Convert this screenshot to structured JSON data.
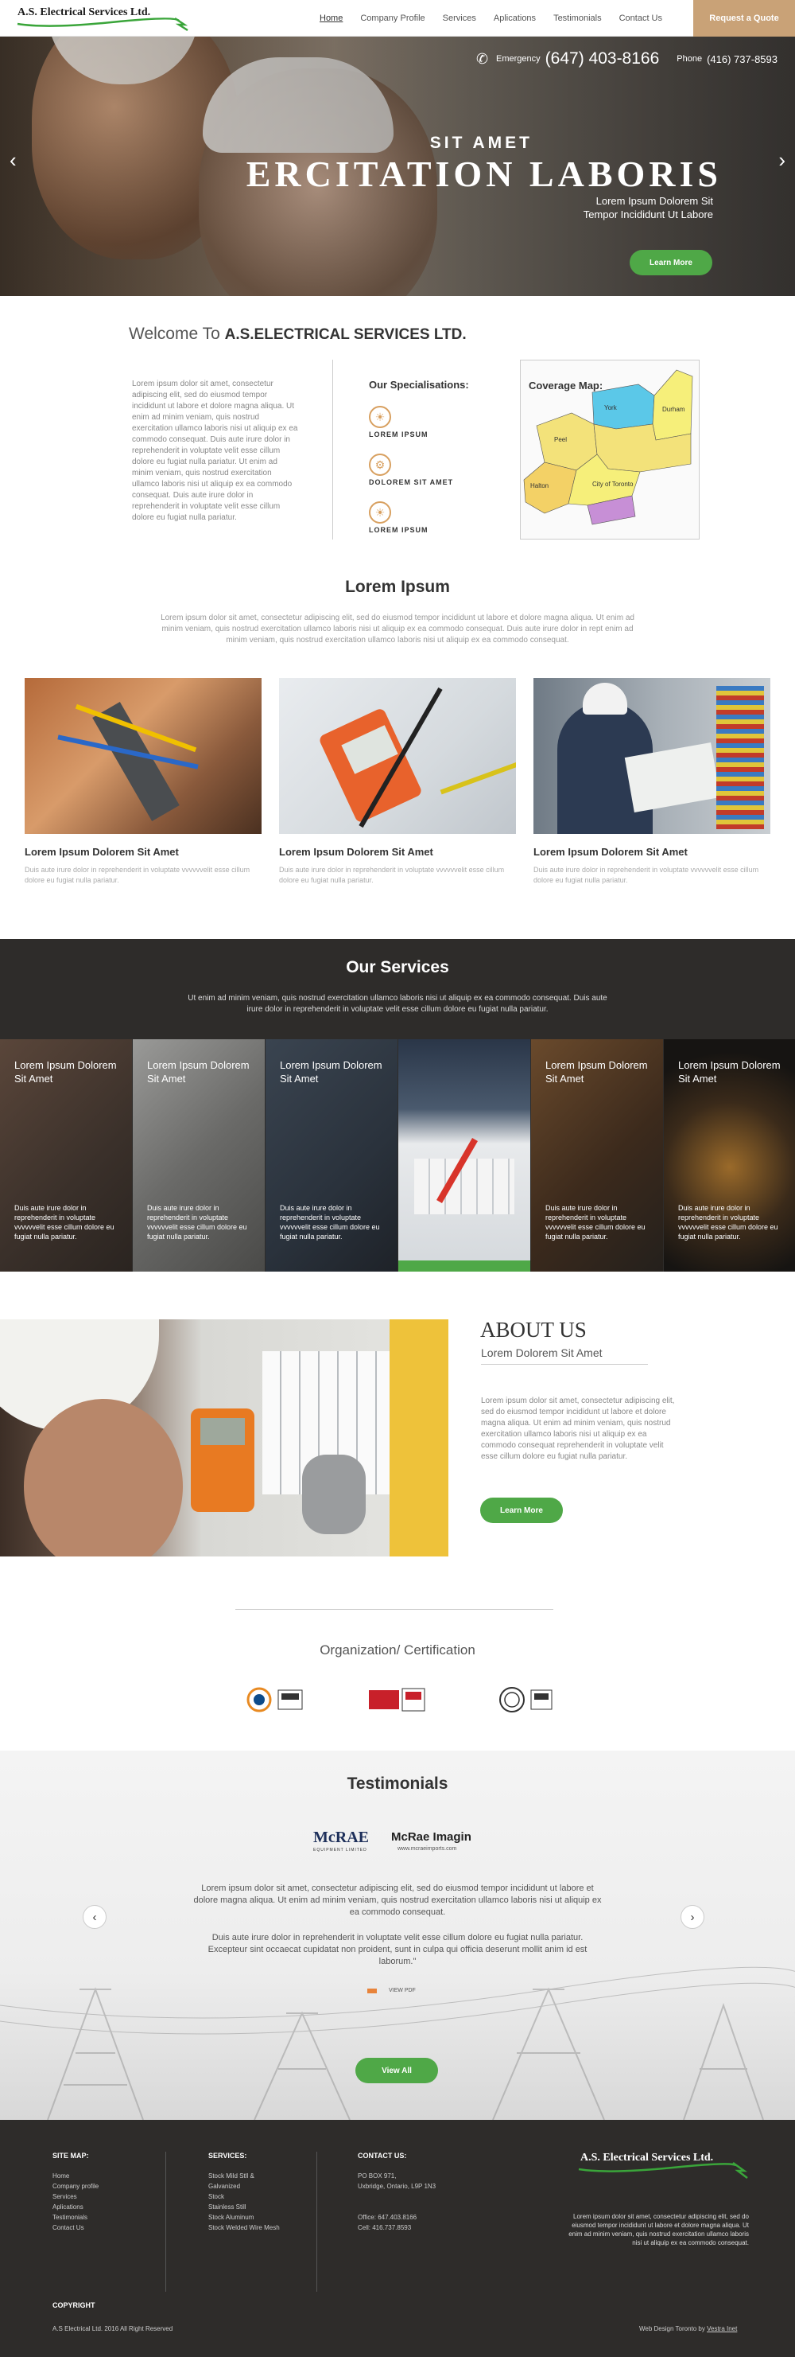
{
  "header": {
    "logo": "A.S. Electrical Services Ltd.",
    "nav": [
      "Home",
      "Company Profile",
      "Services",
      "Aplications",
      "Testimonials",
      "Contact Us"
    ],
    "quote_button": "Request a Quote"
  },
  "hero": {
    "emergency_label": "Emergency",
    "emergency_phone": "(647) 403-8166",
    "phone_label": "Phone",
    "phone": "(416) 737-8593",
    "subtitle": "SIT AMET",
    "title": "ERCITATION LABORIS",
    "tagline_1": "Lorem Ipsum Dolorem Sit",
    "tagline_2": "Tempor Incididunt Ut Labore",
    "button": "Learn More"
  },
  "welcome": {
    "title_prefix": "Welcome To ",
    "title_bold": "A.S.ELECTRICAL SERVICES LTD.",
    "paragraph": "Lorem ipsum dolor sit amet, consectetur adipiscing elit, sed do eiusmod tempor incididunt ut labore et dolore magna aliqua. Ut enim ad minim veniam, quis nostrud exercitation ullamco laboris nisi ut aliquip ex ea commodo consequat. Duis aute irure dolor in reprehenderit in voluptate velit esse cillum dolore eu fugiat nulla pariatur. Ut enim ad minim veniam, quis nostrud exercitation ullamco laboris nisi ut aliquip ex ea commodo consequat. Duis aute irure dolor in reprehenderit in voluptate velit esse cillum dolore eu fugiat nulla pariatur.",
    "specialisations_title": "Our Specialisations:",
    "specialisations": [
      "LOREM IPSUM",
      "DOLOREM SIT AMET",
      "LOREM IPSUM"
    ],
    "map_title": "Coverage Map:",
    "map_regions": [
      "York",
      "Durham",
      "Peel",
      "Halton",
      "City of Toronto"
    ]
  },
  "lorem": {
    "title": "Lorem Ipsum",
    "paragraph": "Lorem ipsum dolor sit amet, consectetur adipiscing elit, sed do eiusmod tempor incididunt ut labore et dolore magna aliqua. Ut enim ad minim veniam, quis nostrud exercitation ullamco laboris nisi ut aliquip ex ea commodo consequat. Duis aute irure dolor in rept enim ad minim veniam, quis nostrud exercitation ullamco laboris nisi ut aliquip ex ea commodo consequat.",
    "cards": [
      {
        "title": "Lorem Ipsum Dolorem Sit Amet",
        "text": "Duis aute irure dolor in reprehenderit in voluptate vvvvvvelit esse cillum dolore eu fugiat nulla pariatur."
      },
      {
        "title": "Lorem Ipsum Dolorem Sit Amet",
        "text": "Duis aute irure dolor in reprehenderit in voluptate vvvvvvelit esse cillum dolore eu fugiat nulla pariatur."
      },
      {
        "title": "Lorem Ipsum Dolorem Sit Amet",
        "text": "Duis aute irure dolor in reprehenderit in voluptate vvvvvvelit esse cillum dolore eu fugiat nulla pariatur."
      }
    ]
  },
  "services": {
    "title": "Our Services",
    "paragraph": "Ut enim ad minim veniam, quis nostrud exercitation ullamco laboris nisi ut aliquip ex ea commodo consequat. Duis aute irure dolor in reprehenderit in voluptate velit esse cillum dolore eu fugiat nulla pariatur.",
    "items": [
      {
        "title": "Lorem Ipsum Dolorem Sit Amet",
        "text": "Duis aute irure dolor in reprehenderit in voluptate vvvvvvelit esse cillum dolore eu fugiat nulla pariatur."
      },
      {
        "title": "Lorem Ipsum Dolorem Sit Amet",
        "text": "Duis aute irure dolor in reprehenderit in voluptate vvvvvvelit esse cillum dolore eu fugiat nulla pariatur."
      },
      {
        "title": "Lorem Ipsum Dolorem Sit Amet",
        "text": "Duis aute irure dolor in reprehenderit in voluptate vvvvvvelit esse cillum dolore eu fugiat nulla pariatur."
      },
      {
        "title": "",
        "text": ""
      },
      {
        "title": "Lorem Ipsum Dolorem Sit Amet",
        "text": "Duis aute irure dolor in reprehenderit in voluptate vvvvvvelit esse cillum dolore eu fugiat nulla pariatur."
      },
      {
        "title": "Lorem Ipsum Dolorem Sit Amet",
        "text": "Duis aute irure dolor in reprehenderit in voluptate vvvvvvelit esse cillum dolore eu fugiat nulla pariatur."
      }
    ]
  },
  "about": {
    "title": "ABOUT US",
    "subtitle": "Lorem Dolorem Sit Amet",
    "paragraph": "Lorem ipsum dolor sit amet, consectetur adipiscing elit, sed do eiusmod tempor incididunt ut labore et dolore magna aliqua. Ut enim ad minim veniam, quis nostrud exercitation ullamco laboris nisi ut aliquip ex ea commodo consequat reprehenderit in voluptate velit esse cillum dolore eu fugiat nulla pariatur.",
    "button": "Learn More"
  },
  "certification": {
    "title": "Organization/ Certification"
  },
  "testimonials": {
    "title": "Testimonials",
    "logo_1": "McRAE",
    "logo_1_sub": "EQUIPMENT LIMITED",
    "logo_2": "McRae Imagin",
    "logo_2_sub": "www.mcraeimports.com",
    "quote_1": "Lorem ipsum dolor sit amet, consectetur adipiscing elit, sed do eiusmod tempor incididunt ut labore et dolore magna aliqua. Ut enim ad minim veniam, quis nostrud exercitation ullamco laboris nisi ut aliquip ex ea commodo consequat.",
    "quote_2": "Duis aute irure dolor in reprehenderit in voluptate velit esse cillum dolore eu fugiat nulla pariatur. Excepteur sint occaecat cupidatat non proident, sunt in culpa qui officia deserunt mollit anim id est laborum.\"",
    "pdf_label": "VIEW PDF",
    "button": "View All"
  },
  "footer": {
    "sitemap_title": "SITE MAP:",
    "sitemap": [
      "Home",
      "Company profile",
      "Services",
      "Aplications",
      "Testimonials",
      "Contact Us"
    ],
    "services_title": "SERVICES:",
    "services": [
      "Stock Mild Stll &",
      "Galvanized",
      "Stock",
      "Stainless Still",
      "Stock Aluminum",
      "Stock Welded Wire Mesh"
    ],
    "contact_title": "CONTACT US:",
    "address_1": "PO BOX 971,",
    "address_2": "Uxbridge, Ontario, L9P 1N3",
    "office": "Office: 647.403.8166",
    "cell": "Cell: 416.737.8593",
    "logo": "A.S. Electrical Services Ltd.",
    "about": "Lorem ipsum dolor sit amet, consectetur adipiscing elit, sed do eiusmod tempor incididunt ut labore et dolore magna aliqua. Ut enim ad minim veniam, quis nostrud exercitation ullamco laboris nisi ut aliquip ex ea commodo consequat.",
    "copyright_title": "COPYRIGHT",
    "copyright": "A.S Electrical Ltd.  2016 All Right Reserved",
    "credit_prefix": "Web Design Toronto by ",
    "credit_link": "Vestra Inet"
  },
  "colors": {
    "accent_green": "#4fa847",
    "quote_tan": "#c9a277",
    "dark_bg": "#2e2c2a"
  }
}
